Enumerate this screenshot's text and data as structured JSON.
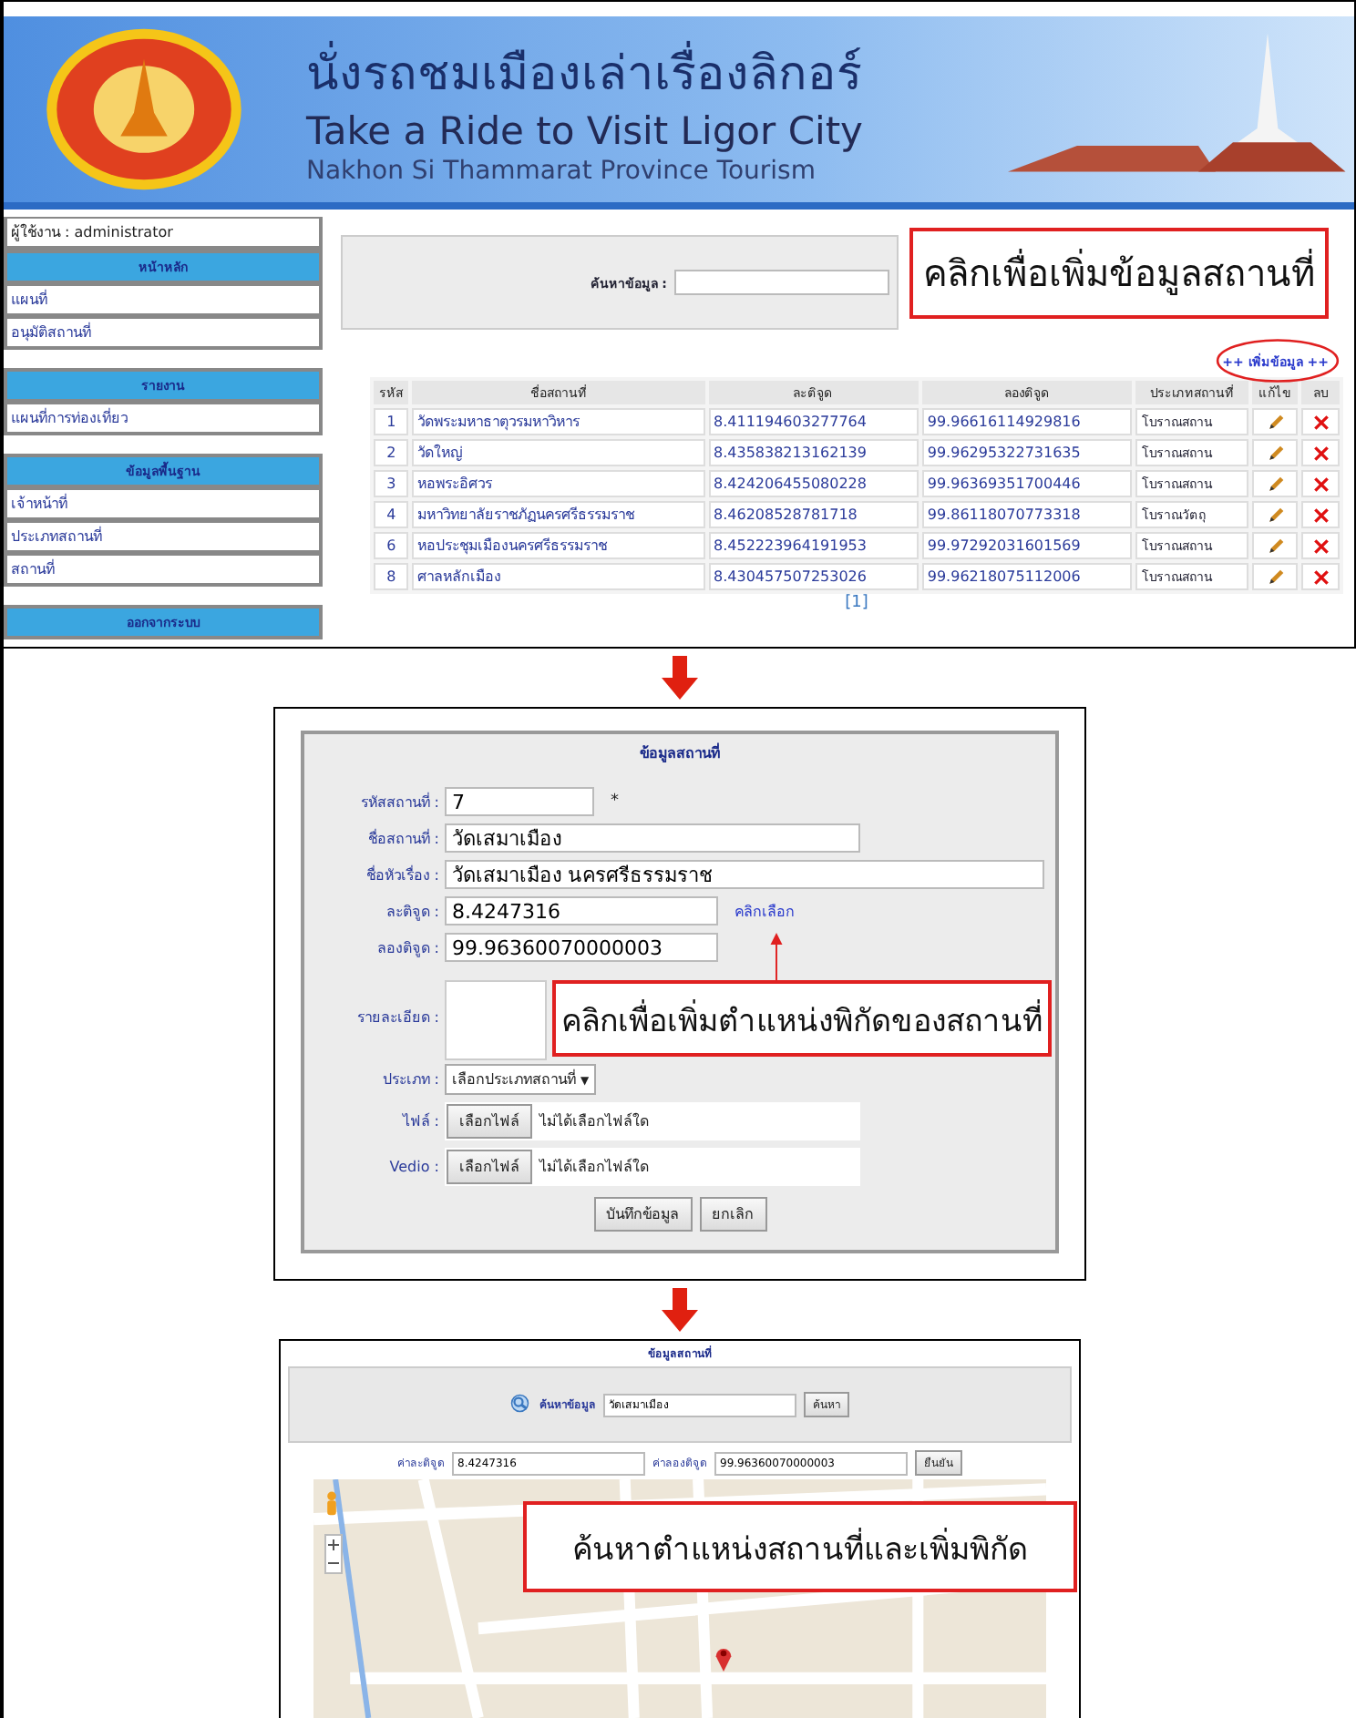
{
  "header": {
    "title_thai": "นั่งรถชมเมืองเล่าเรื่องลิกอร์",
    "title_en": "Take a Ride to Visit Ligor City",
    "subtitle": "Nakhon Si Thammarat Province Tourism"
  },
  "sidebar": {
    "user": "ผู้ใช้งาน : administrator",
    "sections": [
      {
        "title": "หน้าหลัก",
        "items": [
          "แผนที่",
          "อนุมัติสถานที่"
        ]
      },
      {
        "title": "รายงาน",
        "items": [
          "แผนที่การท่องเที่ยว"
        ]
      },
      {
        "title": "ข้อมูลพื้นฐาน",
        "items": [
          "เจ้าหน้าที่",
          "ประเภทสถานที่",
          "สถานที่"
        ]
      },
      {
        "title": "ออกจากระบบ"
      }
    ]
  },
  "list_page": {
    "search_label": "ค้นหาข้อมูล :",
    "callout": "คลิกเพื่อเพิ่มข้อมูลสถานที่",
    "add_link": "++ เพิ่มข้อมูล ++",
    "table": {
      "columns": [
        "รหัส",
        "ชื่อสถานที่",
        "ละติจูด",
        "ลองติจูด",
        "ประเภทสถานที่",
        "แก้ไข",
        "ลบ"
      ],
      "rows": [
        [
          "1",
          "วัดพระมหาธาตุวรมหาวิหาร",
          "8.411194603277764",
          "99.96616114929816",
          "โบราณสถาน"
        ],
        [
          "2",
          "วัดใหญ่",
          "8.435838213162139",
          "99.96295322731635",
          "โบราณสถาน"
        ],
        [
          "3",
          "หอพระอิศวร",
          "8.424206455080228",
          "99.96369351700446",
          "โบราณสถาน"
        ],
        [
          "4",
          "มหาวิทยาลัยราชภัฏนครศรีธรรมราช",
          "8.46208528781718",
          "99.86118070773318",
          "โบราณวัตถุ"
        ],
        [
          "6",
          "หอประชุมเมืองนครศรีธรรมราช",
          "8.452223964191953",
          "99.97292031601569",
          "โบราณสถาน"
        ],
        [
          "8",
          "ศาลหลักเมือง",
          "8.430457507253026",
          "99.96218075112006",
          "โบราณสถาน"
        ]
      ]
    },
    "pager": "[1]"
  },
  "form_page": {
    "title": "ข้อมูลสถานที่",
    "callout": "คลิกเพื่อเพิ่มตำแหน่งพิกัดของสถานที่",
    "fields": [
      {
        "kind": "text",
        "label": "รหัสสถานที่ :",
        "value": "7",
        "suffix": "*"
      },
      {
        "kind": "text",
        "label": "ชื่อสถานที่ :",
        "value": "วัดเสมาเมือง"
      },
      {
        "kind": "text",
        "label": "ชื่อหัวเรื่อง :",
        "value": "วัดเสมาเมือง นครศรีธรรมราช"
      },
      {
        "kind": "text",
        "label": "ละติจูด :",
        "value": "8.4247316",
        "link": "คลิกเลือก"
      },
      {
        "kind": "text",
        "label": "ลองติจูด :",
        "value": "99.96360070000003"
      },
      {
        "kind": "textarea",
        "label": "รายละเอียด :"
      },
      {
        "kind": "select",
        "label": "ประเภท :",
        "value": "เลือกประเภทสถานที่",
        "caret": "▼"
      },
      {
        "kind": "file",
        "label": "ไฟล์ :",
        "button": "เลือกไฟล์",
        "status": "ไม่ได้เลือกไฟล์ใด"
      },
      {
        "kind": "file",
        "label": "Vedio :",
        "button": "เลือกไฟล์",
        "status": "ไม่ได้เลือกไฟล์ใด"
      }
    ],
    "buttons": [
      "บันทึกข้อมูล",
      "ยกเลิก"
    ]
  },
  "map_page": {
    "title": "ข้อมูลสถานที่",
    "search_label": "ค้นหาข้อมูล",
    "search_value": "วัดเสมาเมือง",
    "search_button": "ค้นหา",
    "lat_label": "ค่าละติจูด",
    "lat_value": "8.4247316",
    "lng_label": "ค่าลองติจูด",
    "lng_value": "99.96360070000003",
    "confirm_button": "ยืนยัน",
    "callout": "ค้นหาตำแหน่งสถานที่และเพิ่มพิกัด"
  }
}
